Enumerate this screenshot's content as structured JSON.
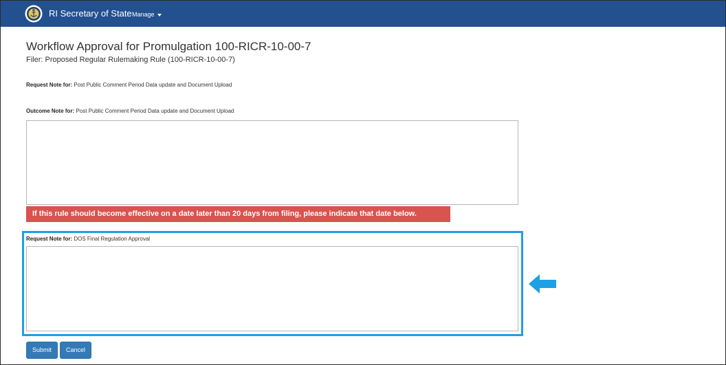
{
  "colors": {
    "navbar": "#23508f",
    "alert": "#d9534f",
    "highlight": "#1ea0e6",
    "button": "#337ab7"
  },
  "navbar": {
    "logo_icon": "seal-anchor-icon",
    "brand": "RI Secretary of State",
    "manage_label": "Manage"
  },
  "page": {
    "title": "Workflow Approval for Promulgation 100-RICR-10-00-7",
    "filer": "Filer: Proposed Regular Rulemaking Rule (100-RICR-10-00-7)"
  },
  "request_note_1": {
    "label": "Request Note for:",
    "value": "Post Public Comment Period Data update and Document Upload"
  },
  "outcome_note": {
    "label": "Outcome Note for:",
    "value": "Post Public Comment Period Data update and Document Upload",
    "text": ""
  },
  "alert": {
    "text": "If this rule should become effective on a date later than 20 days from filing, please indicate that date below."
  },
  "request_note_2": {
    "label": "Request Note for:",
    "value": "DOS Final Regulation Approval",
    "text": ""
  },
  "annotation": {
    "arrow_icon": "arrow-left-icon"
  },
  "buttons": {
    "submit": "Submit",
    "cancel": "Cancel"
  }
}
